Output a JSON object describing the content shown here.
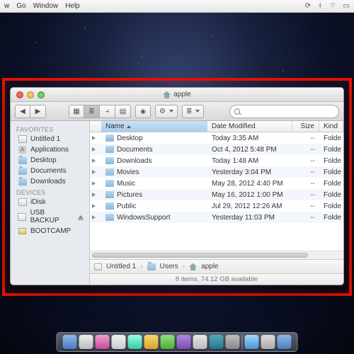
{
  "menubar": {
    "items": [
      "w",
      "Go",
      "Window",
      "Help"
    ]
  },
  "window": {
    "title": "apple"
  },
  "toolbar": {
    "search_placeholder": ""
  },
  "columns": {
    "name": "Name",
    "date": "Date Modified",
    "size": "Size",
    "kind": "Kind"
  },
  "sidebar": {
    "favorites_header": "FAVORITES",
    "favorites": [
      {
        "label": "Untitled 1"
      },
      {
        "label": "Applications"
      },
      {
        "label": "Desktop"
      },
      {
        "label": "Documents"
      },
      {
        "label": "Downloads"
      }
    ],
    "devices_header": "DEVICES",
    "devices": [
      {
        "label": "iDisk",
        "eject": false
      },
      {
        "label": "USB BACKUP",
        "eject": true
      },
      {
        "label": "BOOTCAMP",
        "eject": false
      }
    ]
  },
  "rows": [
    {
      "name": "Desktop",
      "date": "Today 3:35 AM",
      "size": "--",
      "kind": "Folde"
    },
    {
      "name": "Documents",
      "date": "Oct 4, 2012 5:48 PM",
      "size": "--",
      "kind": "Folde"
    },
    {
      "name": "Downloads",
      "date": "Today 1:48 AM",
      "size": "--",
      "kind": "Folde"
    },
    {
      "name": "Movies",
      "date": "Yesterday 3:04 PM",
      "size": "--",
      "kind": "Folde"
    },
    {
      "name": "Music",
      "date": "May 28, 2012 4:40 PM",
      "size": "--",
      "kind": "Folde"
    },
    {
      "name": "Pictures",
      "date": "May 16, 2012 1:00 PM",
      "size": "--",
      "kind": "Folde"
    },
    {
      "name": "Public",
      "date": "Jul 29, 2012 12:26 AM",
      "size": "--",
      "kind": "Folde"
    },
    {
      "name": "WindowsSupport",
      "date": "Yesterday 11:03 PM",
      "size": "--",
      "kind": "Folde"
    }
  ],
  "path": [
    {
      "label": "Untitled 1"
    },
    {
      "label": "Users"
    },
    {
      "label": "apple"
    }
  ],
  "status": "8 items, 74.12 GB available"
}
